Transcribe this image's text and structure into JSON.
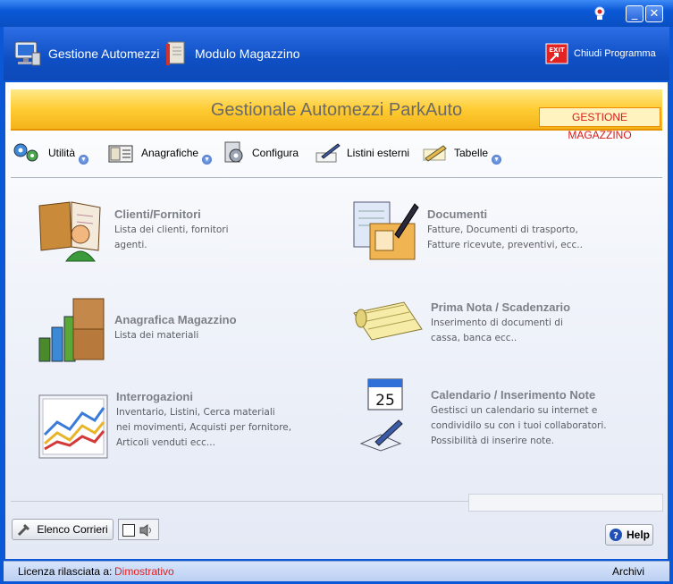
{
  "window": {
    "minimize_glyph": "_",
    "close_glyph": "✕"
  },
  "appbar": {
    "gestione_label": "Gestione Automezzi",
    "magazzino_label": "Modulo Magazzino",
    "exit_label": "Chiudi Programma",
    "exit_icon_text": "EXIT"
  },
  "banner": {
    "title": "Gestionale Automezzi ParkAuto",
    "tag": "GESTIONE MAGAZZINO"
  },
  "toolbar": {
    "utilita": "Utilità",
    "anagrafiche": "Anagrafiche",
    "configura": "Configura",
    "listini": "Listini esterni",
    "tabelle": "Tabelle"
  },
  "modules": {
    "clienti": {
      "title": "Clienti/Fornitori",
      "desc1": "Lista dei clienti, fornitori",
      "desc2": "agenti."
    },
    "documenti": {
      "title": "Documenti",
      "desc1": "Fatture, Documenti di trasporto,",
      "desc2": "Fatture ricevute, preventivi, ecc.."
    },
    "anagrafica": {
      "title": "Anagrafica Magazzino",
      "desc1": "Lista dei materiali"
    },
    "primanota": {
      "title": "Prima Nota / Scadenzario",
      "desc1": "Inserimento di documenti di",
      "desc2": "cassa, banca ecc.."
    },
    "interrogazioni": {
      "title": "Interrogazioni",
      "desc1": "Inventario, Listini, Cerca materiali",
      "desc2": "nei movimenti, Acquisti per fornitore,",
      "desc3": "Articoli venduti ecc..."
    },
    "calendario": {
      "title": "Calendario / Inserimento Note",
      "desc1": "Gestisci un calendario su internet e",
      "desc2": "condividilo su con i tuoi collaboratori.",
      "desc3": "Possibilità di inserire note.",
      "day": "25"
    }
  },
  "bottom": {
    "corrieri_label": "Elenco Corrieri",
    "help_label": "Help"
  },
  "status": {
    "license_label": "Licenza rilasciata a:",
    "license_value": "Dimostrativo",
    "archivi": "Archivi"
  },
  "colors": {
    "window_blue": "#0a58d6",
    "banner_yellow": "#ffcc33",
    "tag_red": "#d81a1a",
    "license_red": "#e02020"
  },
  "icons": [
    "user-icon",
    "minimize-icon",
    "close-icon",
    "computer-icon",
    "book-icon",
    "exit-icon",
    "gears-icon",
    "address-book-icon",
    "config-icon",
    "pen-icon",
    "pencil-icon",
    "contacts-book-icon",
    "documents-icon",
    "boxes-chart-icon",
    "notepad-icon",
    "line-chart-icon",
    "calendar-icon",
    "notes-icon",
    "tool-icon",
    "speaker-icon",
    "help-icon"
  ]
}
